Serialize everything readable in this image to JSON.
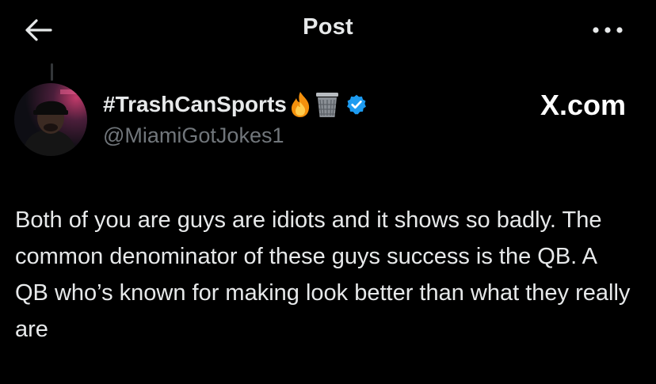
{
  "header": {
    "title": "Post",
    "back_icon": "arrow-left-icon",
    "more_icon": "more-horizontal-icon"
  },
  "author": {
    "display_name": "#TrashCanSports",
    "handle": "@MiamiGotJokes1",
    "badges": [
      "fire-emoji",
      "wastebasket-emoji",
      "verified-badge-icon"
    ],
    "verified_color": "#1d9bf0"
  },
  "watermark": {
    "text": "X.com"
  },
  "post": {
    "text": "Both of you are guys are idiots and it shows so badly. The common denominator of these guys success is the QB. A QB who’s known for making look better than what they really are"
  },
  "colors": {
    "background": "#000000",
    "primary_text": "#e7e9ea",
    "secondary_text": "#71767b",
    "accent": "#1d9bf0"
  }
}
